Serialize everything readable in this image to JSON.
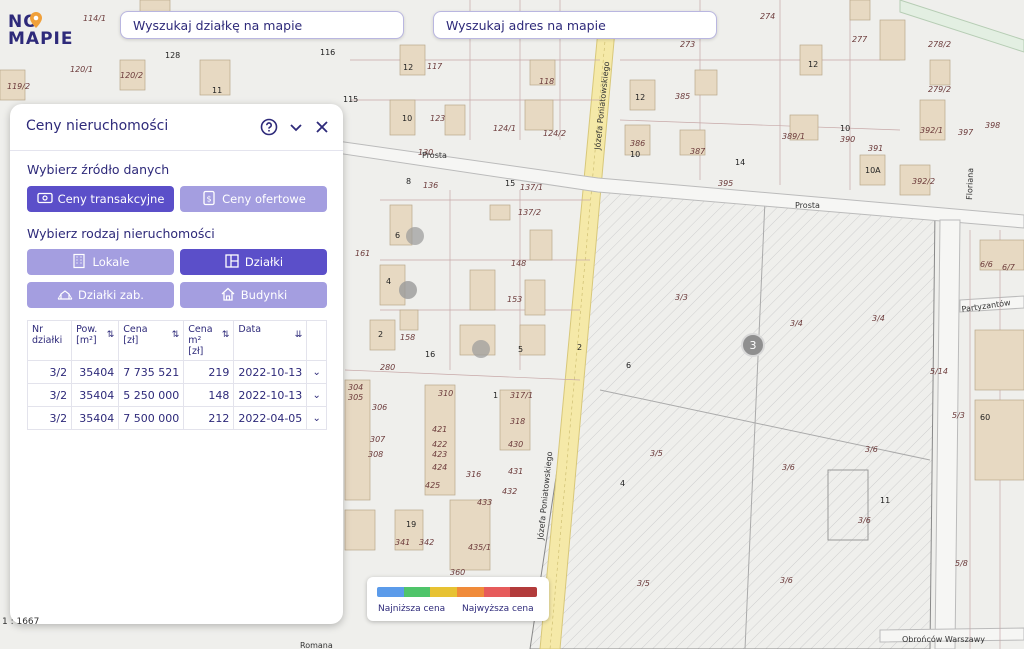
{
  "logo": {
    "line1": "NO",
    "line2": "MAPIE"
  },
  "search": {
    "parcel_label": "Wyszukaj działkę na mapie",
    "address_label": "Wyszukaj adres na mapie"
  },
  "panel": {
    "title": "Ceny nieruchomości",
    "source_section": "Wybierz źródło danych",
    "source_buttons": [
      {
        "label": "Ceny transakcyjne",
        "icon": "banknote-icon",
        "active": true
      },
      {
        "label": "Ceny ofertowe",
        "icon": "price-tag-icon",
        "active": false
      }
    ],
    "type_section": "Wybierz rodzaj nieruchomości",
    "type_buttons": [
      {
        "label": "Lokale",
        "icon": "building-icon",
        "active": false
      },
      {
        "label": "Działki",
        "icon": "parcel-icon",
        "active": true
      },
      {
        "label": "Działki zab.",
        "icon": "built-parcel-icon",
        "active": false
      },
      {
        "label": "Budynki",
        "icon": "house-icon",
        "active": false
      }
    ],
    "table": {
      "headers": [
        {
          "line1": "Nr",
          "line2": "działki",
          "sort": ""
        },
        {
          "line1": "Pow.",
          "line2": "[m²]",
          "sort": "⇅"
        },
        {
          "line1": "Cena",
          "line2": "[zł]",
          "sort": "⇅"
        },
        {
          "line1": "Cena m²",
          "line2": "[zł]",
          "sort": "⇅"
        },
        {
          "line1": "Data",
          "line2": "",
          "sort": "⇊"
        }
      ],
      "rows": [
        {
          "nr": "3/2",
          "area": "35404",
          "price": "7 735 521",
          "price_m2": "219",
          "date": "2022-10-13"
        },
        {
          "nr": "3/2",
          "area": "35404",
          "price": "5 250 000",
          "price_m2": "148",
          "date": "2022-10-13"
        },
        {
          "nr": "3/2",
          "area": "35404",
          "price": "7 500 000",
          "price_m2": "212",
          "date": "2022-04-05"
        }
      ]
    }
  },
  "legend": {
    "colors": [
      "#5b9bea",
      "#4fc46a",
      "#e7c233",
      "#f08b3a",
      "#e65b5b",
      "#b23b3b"
    ],
    "low_label": "Najniższa cena",
    "high_label": "Najwyższa cena"
  },
  "map": {
    "street_labels": [
      "Prosta",
      "Józefa Poniatowskiego",
      "Floriana",
      "Partyzantów",
      "Obrońców Warszawy",
      "Romana"
    ],
    "cluster_label": "3",
    "scale_text": "1 : 1667"
  }
}
